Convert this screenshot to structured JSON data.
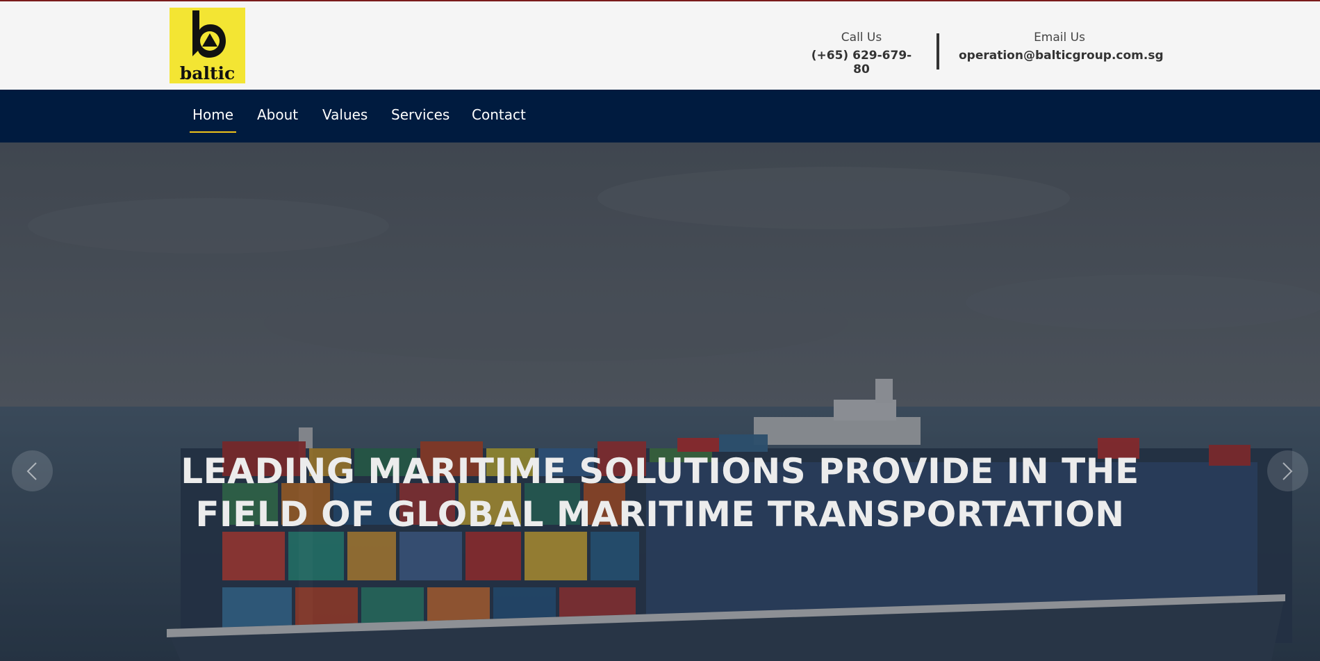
{
  "brand": {
    "logo_text": "baltic",
    "logo_color": "#f3e533"
  },
  "header": {
    "call": {
      "label": "Call Us",
      "value": "(+65) 629-679-80"
    },
    "email": {
      "label": "Email Us",
      "value": "operation@balticgroup.com.sg"
    }
  },
  "nav": {
    "items": [
      {
        "label": "Home",
        "active": true
      },
      {
        "label": "About"
      },
      {
        "label": "Values"
      },
      {
        "label": "Services"
      },
      {
        "label": "Contact"
      }
    ],
    "background": "#001b3f",
    "active_underline": "#f0c419"
  },
  "hero": {
    "title_line1": "LEADING MARITIME SOLUTIONS PROVIDE IN THE",
    "title_line2": "FIELD OF GLOBAL MARITIME TRANSPORTATION",
    "prev_icon": "chevron-left-icon",
    "next_icon": "chevron-right-icon"
  }
}
